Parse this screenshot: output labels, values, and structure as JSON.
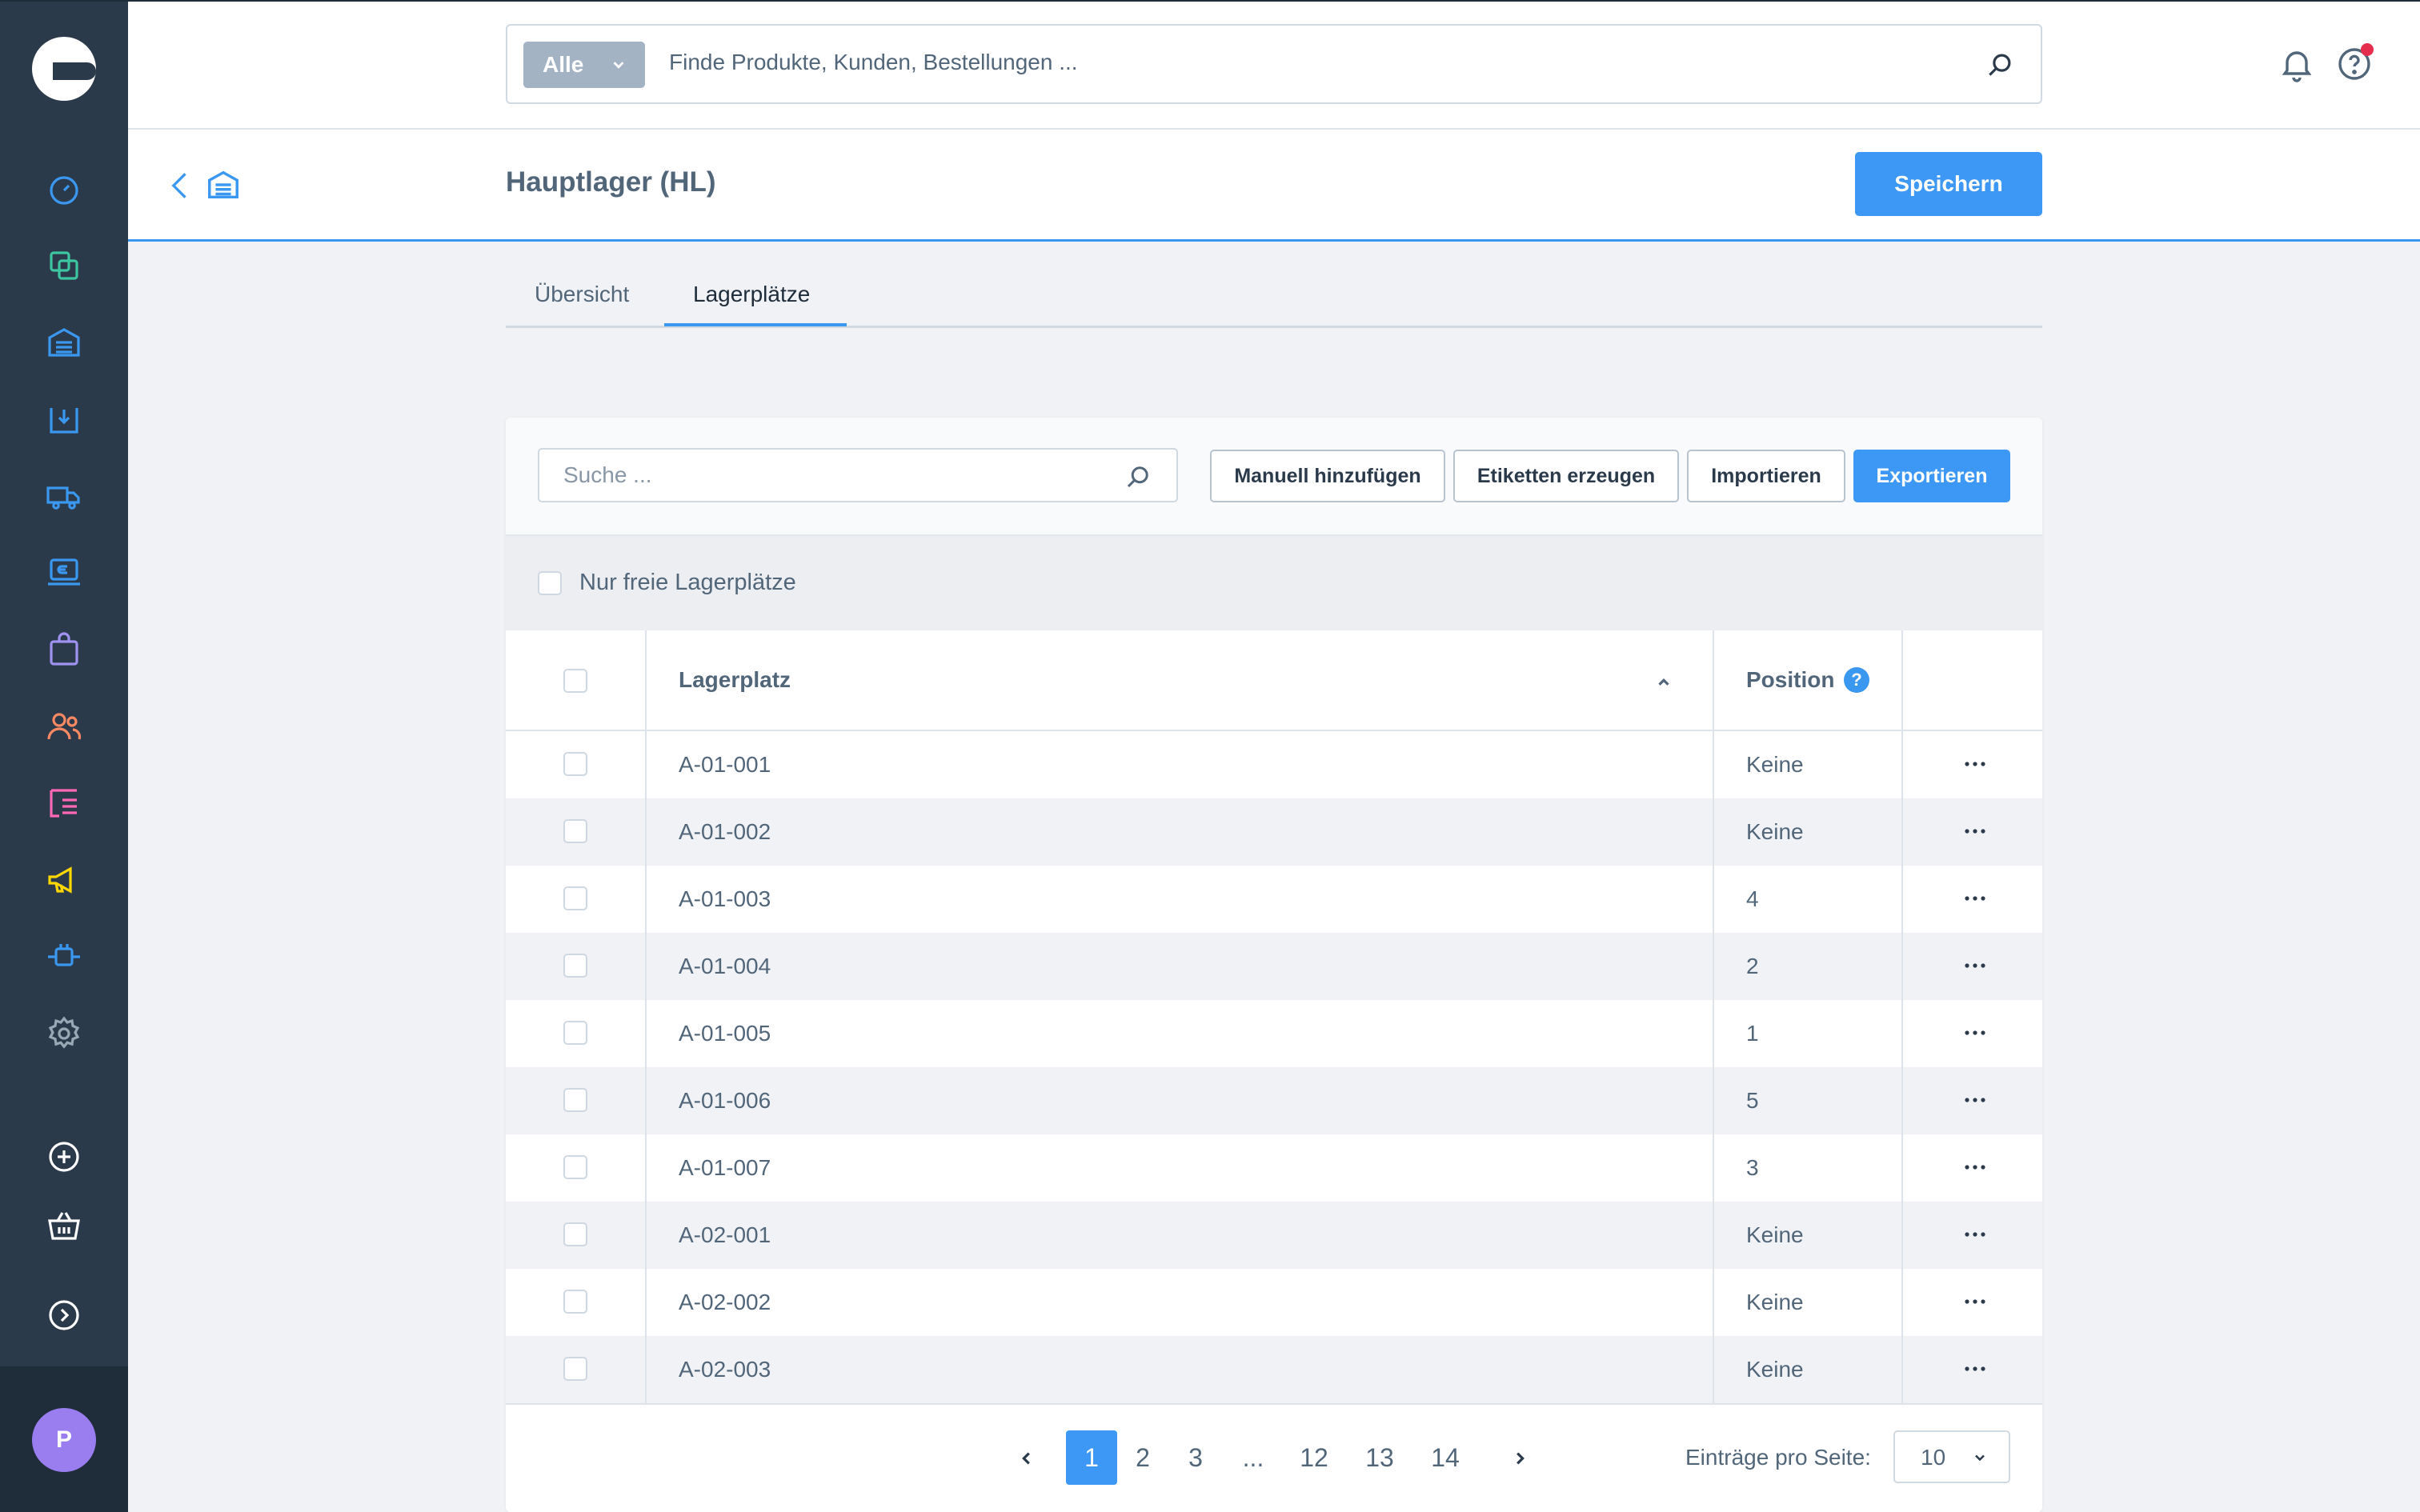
{
  "header": {
    "search_scope": "Alle",
    "search_placeholder": "Finde Produkte, Kunden, Bestellungen ..."
  },
  "smartbar": {
    "title": "Hauptlager (HL)",
    "save_label": "Speichern"
  },
  "tabs": [
    {
      "label": "Übersicht"
    },
    {
      "label": "Lagerplätze"
    }
  ],
  "toolbar": {
    "search_placeholder": "Suche ...",
    "buttons": [
      "Manuell hinzufügen",
      "Etiketten erzeugen",
      "Importieren",
      "Exportieren"
    ]
  },
  "filter": {
    "label": "Nur freie Lagerplätze"
  },
  "table": {
    "columns": [
      "Lagerplatz",
      "Position"
    ],
    "help_glyph": "?",
    "rows": [
      {
        "name": "A-01-001",
        "position": "Keine"
      },
      {
        "name": "A-01-002",
        "position": "Keine"
      },
      {
        "name": "A-01-003",
        "position": "4"
      },
      {
        "name": "A-01-004",
        "position": "2"
      },
      {
        "name": "A-01-005",
        "position": "1"
      },
      {
        "name": "A-01-006",
        "position": "5"
      },
      {
        "name": "A-01-007",
        "position": "3"
      },
      {
        "name": "A-02-001",
        "position": "Keine"
      },
      {
        "name": "A-02-002",
        "position": "Keine"
      },
      {
        "name": "A-02-003",
        "position": "Keine"
      }
    ]
  },
  "pagination": {
    "pages": [
      "1",
      "2",
      "3",
      "...",
      "12",
      "13",
      "14"
    ],
    "current": "1",
    "per_page_label": "Einträge pro Seite:",
    "per_page_value": "10"
  },
  "user": {
    "avatar_initial": "P"
  },
  "colors": {
    "sidebar": "#2b3a4a",
    "accent": "#3d98f5",
    "notification_dot": "#e52d4d",
    "avatar": "#9a7ef0"
  },
  "icons": {
    "sidebar": [
      "dashboard-icon",
      "catalog-icon",
      "warehouse-icon",
      "inbound-icon",
      "shipping-icon",
      "payment-icon",
      "orders-icon",
      "customers-icon",
      "content-icon",
      "marketing-icon",
      "extensions-icon",
      "settings-icon",
      "add-icon",
      "shop-icon",
      "expand-icon"
    ],
    "header": [
      "search-icon",
      "bell-icon",
      "help-icon"
    ]
  }
}
